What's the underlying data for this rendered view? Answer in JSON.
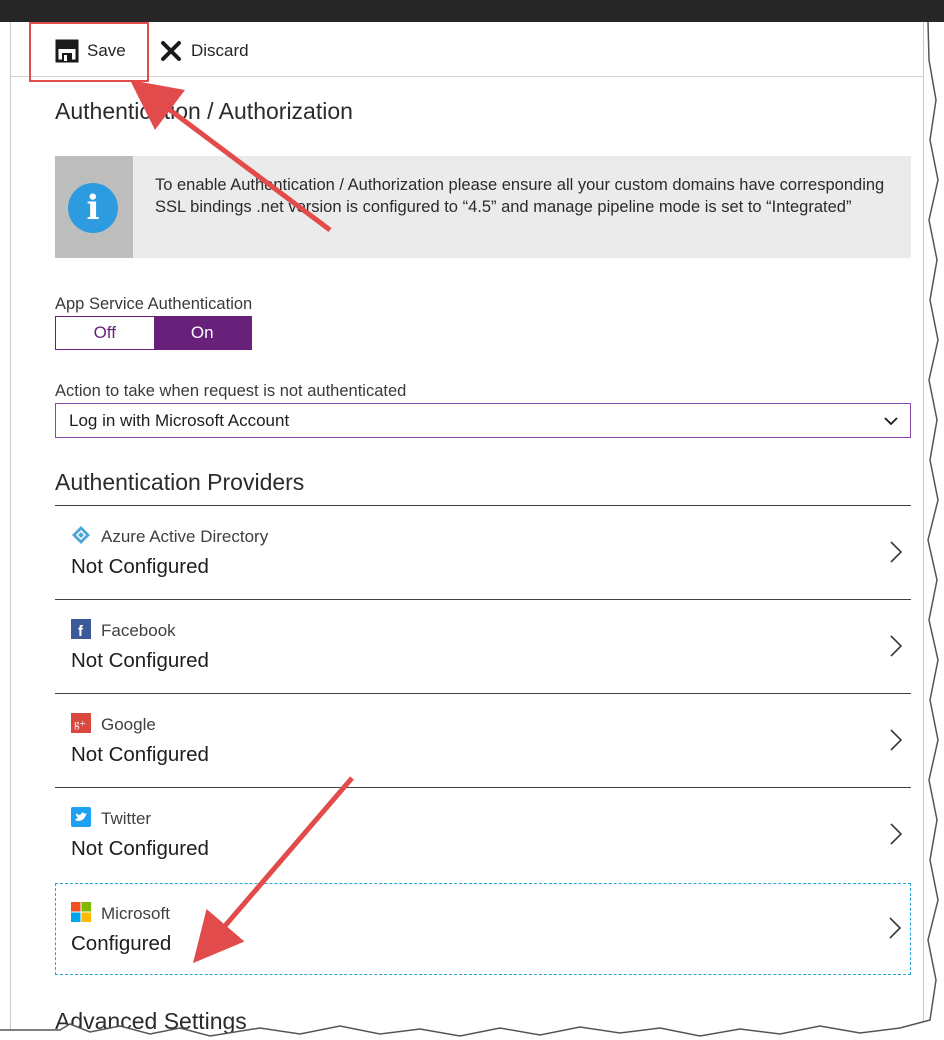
{
  "toolbar": {
    "save_label": "Save",
    "discard_label": "Discard"
  },
  "page": {
    "title": "Authentication / Authorization"
  },
  "info": {
    "text": "To enable Authentication / Authorization please ensure all your custom domains have corresponding SSL bindings .net version is configured to “4.5” and manage pipeline mode is set to “Integrated”"
  },
  "app_service_auth": {
    "label": "App Service Authentication",
    "off_label": "Off",
    "on_label": "On",
    "value": "On"
  },
  "action": {
    "label": "Action to take when request is not authenticated",
    "selected": "Log in with Microsoft Account"
  },
  "providers": {
    "heading": "Authentication Providers",
    "items": [
      {
        "name": "Azure Active Directory",
        "status": "Not Configured",
        "icon": "azure-ad-icon"
      },
      {
        "name": "Facebook",
        "status": "Not Configured",
        "icon": "facebook-icon"
      },
      {
        "name": "Google",
        "status": "Not Configured",
        "icon": "google-icon"
      },
      {
        "name": "Twitter",
        "status": "Not Configured",
        "icon": "twitter-icon"
      },
      {
        "name": "Microsoft",
        "status": "Configured",
        "icon": "microsoft-icon"
      }
    ]
  },
  "advanced": {
    "heading": "Advanced Settings"
  },
  "colors": {
    "accent": "#68217a",
    "annotation": "#e24b4b",
    "info": "#2d9be0",
    "selection": "#27a3dc"
  }
}
